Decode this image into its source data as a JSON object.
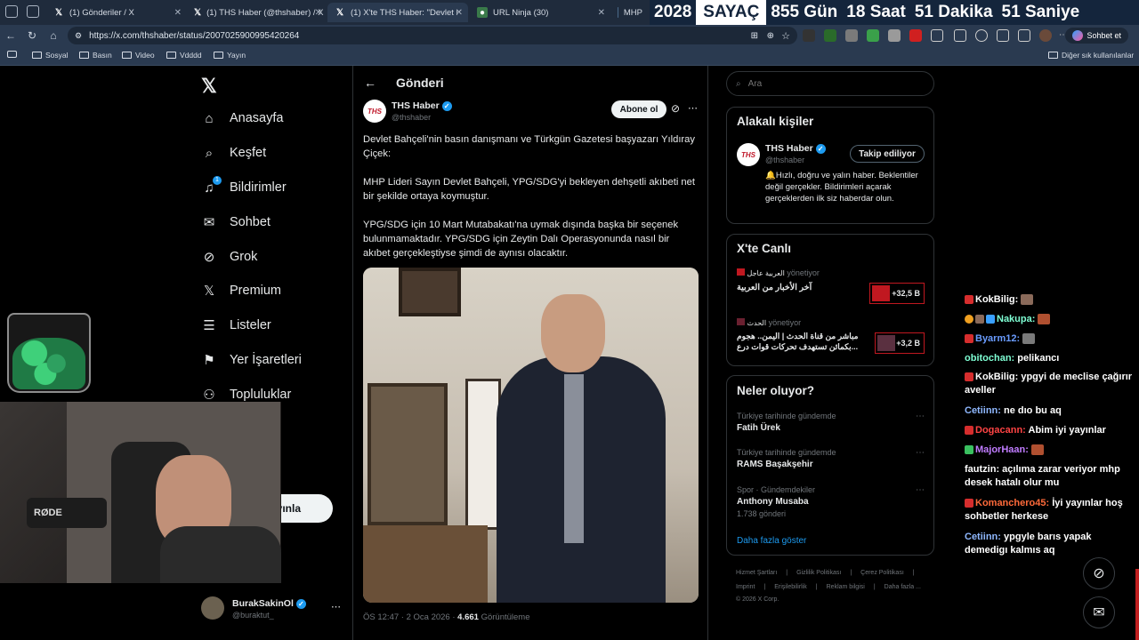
{
  "browser": {
    "tabs": [
      {
        "label": "(1) Gönderiler / X",
        "icon": "x-logo-icon"
      },
      {
        "label": "(1) THS Haber (@thshaber) / X",
        "icon": "x-logo-icon"
      },
      {
        "label": "(1) X'te THS Haber: \"Devlet Bahçeli",
        "icon": "x-logo-icon"
      },
      {
        "label": "URL Ninja (30)",
        "icon": "url-ninja-icon"
      },
      {
        "label": "MHP",
        "icon": "page-icon"
      }
    ],
    "url": "https://x.com/thshaber/status/2007025900995420264",
    "profile_button": "Sohbet et",
    "bookmarks": [
      "Sosyal",
      "Basın",
      "Video",
      "Vdddd",
      "Yayın"
    ],
    "other_bookmarks": "Diğer sık kullanılanlar"
  },
  "counter": {
    "year": "2028",
    "label": "SAYAÇ",
    "days": "855 Gün",
    "hours": "18 Saat",
    "minutes": "51 Dakika",
    "seconds": "51 Saniye"
  },
  "nav": {
    "items": [
      {
        "label": "Anasayfa",
        "icon": "home-icon"
      },
      {
        "label": "Keşfet",
        "icon": "search-icon"
      },
      {
        "label": "Bildirimler",
        "icon": "bell-icon",
        "badge": "1"
      },
      {
        "label": "Sohbet",
        "icon": "mail-icon"
      },
      {
        "label": "Grok",
        "icon": "grok-icon"
      },
      {
        "label": "Premium",
        "icon": "x-logo-icon"
      },
      {
        "label": "Listeler",
        "icon": "list-icon"
      },
      {
        "label": "Yer İşaretleri",
        "icon": "bookmark-icon"
      },
      {
        "label": "Topluluklar",
        "icon": "people-icon"
      }
    ],
    "post_button_partial": "yınla",
    "partial_item": "a",
    "account_name": "BurakSakinOl",
    "account_handle": "@buraktut_"
  },
  "post": {
    "header_title": "Gönderi",
    "author_name": "THS Haber",
    "author_handle": "@thshaber",
    "avatar_text": "THS",
    "subscribe_label": "Abone ol",
    "paragraphs": [
      "Devlet Bahçeli'nin basın danışmanı ve Türkgün Gazetesi başyazarı Yıldıray Çiçek:",
      "MHP Lideri Sayın Devlet Bahçeli, YPG/SDG'yi bekleyen dehşetli akıbeti net bir şekilde ortaya koymuştur.",
      "YPG/SDG için 10 Mart Mutabakatı'na uymak dışında başka bir seçenek bulunmamaktadır. YPG/SDG için Zeytin Dalı Operasyonunda nasıl bir akıbet gerçekleştiyse şimdi de aynısı olacaktır."
    ],
    "timestamp": "ÖS 12:47 · 2 Oca 2026 ·",
    "views_count": "4.661",
    "views_label": "Görüntüleme"
  },
  "right": {
    "search_placeholder": "Ara",
    "related_title": "Alakalı kişiler",
    "related": {
      "name": "THS Haber",
      "handle": "@thshaber",
      "follow_label": "Takip ediliyor",
      "bio": "🔔Hızlı, doğru ve yalın haber. Beklentiler değil gerçekler. Bildirimleri açarak gerçeklerden ilk siz haberdar olun."
    },
    "live_title": "X'te Canlı",
    "live": [
      {
        "host": "العربية عاجل",
        "role": "yönetiyor",
        "title": "آخر الأخبار من العربية",
        "count": "+32,5 B"
      },
      {
        "host": "الحدث",
        "role": "yönetiyor",
        "title": "مباشر من قناة الحدث | اليمن.. هجوم بكمائن تستهدف تحركات قوات درع...",
        "count": "+3,2 B"
      }
    ],
    "trends_title": "Neler oluyor?",
    "trends": [
      {
        "context": "Türkiye tarihinde gündemde",
        "name": "Fatih Ürek",
        "posts": ""
      },
      {
        "context": "Türkiye tarihinde gündemde",
        "name": "RAMS Başakşehir",
        "posts": ""
      },
      {
        "context": "Spor · Gündemdekiler",
        "name": "Anthony Musaba",
        "posts": "1.738 gönderi"
      }
    ],
    "show_more": "Daha fazla göster",
    "footer_line1": [
      "Hizmet Şartları",
      "Gizlilik Politikası",
      "Çerez Politikası"
    ],
    "footer_line2": [
      "Imprint",
      "Erişilebilirlik",
      "Reklam bilgisi",
      "Daha fazla ..."
    ],
    "copyright": "© 2026 X Corp."
  },
  "chat": [
    {
      "user": "KokBilig:",
      "color": "#ffffff",
      "msg": ""
    },
    {
      "user": "Nakupa:",
      "color": "#7fffd4",
      "msg": ""
    },
    {
      "user": "Byarm12:",
      "color": "#6a9cff",
      "msg": ""
    },
    {
      "user": "obitochan:",
      "color": "#7fffd4",
      "msg": "pelikancı"
    },
    {
      "user": "KokBilig:",
      "color": "#ffffff",
      "msg": "ypgyi de meclise çağırır aveller"
    },
    {
      "user": "Cetiinn:",
      "color": "#8fb8ff",
      "msg": "ne dıo bu aq"
    },
    {
      "user": "Dogacann:",
      "color": "#ff4444",
      "msg": "Abim iyi yayınlar"
    },
    {
      "user": "MajorHaan:",
      "color": "#c07cff",
      "msg": ""
    },
    {
      "user": "fautzin:",
      "color": "#ffffff",
      "msg": "açılıma zarar veriyor mhp desek hatalı olur mu"
    },
    {
      "user": "Komanchero45:",
      "color": "#ff6a3a",
      "msg": "İyi yayınlar hoş sohbetler herkese"
    },
    {
      "user": "Cetiinn:",
      "color": "#8fb8ff",
      "msg": "ypgyle barıs yapak demedigı kalmıs aq"
    }
  ],
  "webcam": {
    "mic_brand": "RØDE"
  }
}
